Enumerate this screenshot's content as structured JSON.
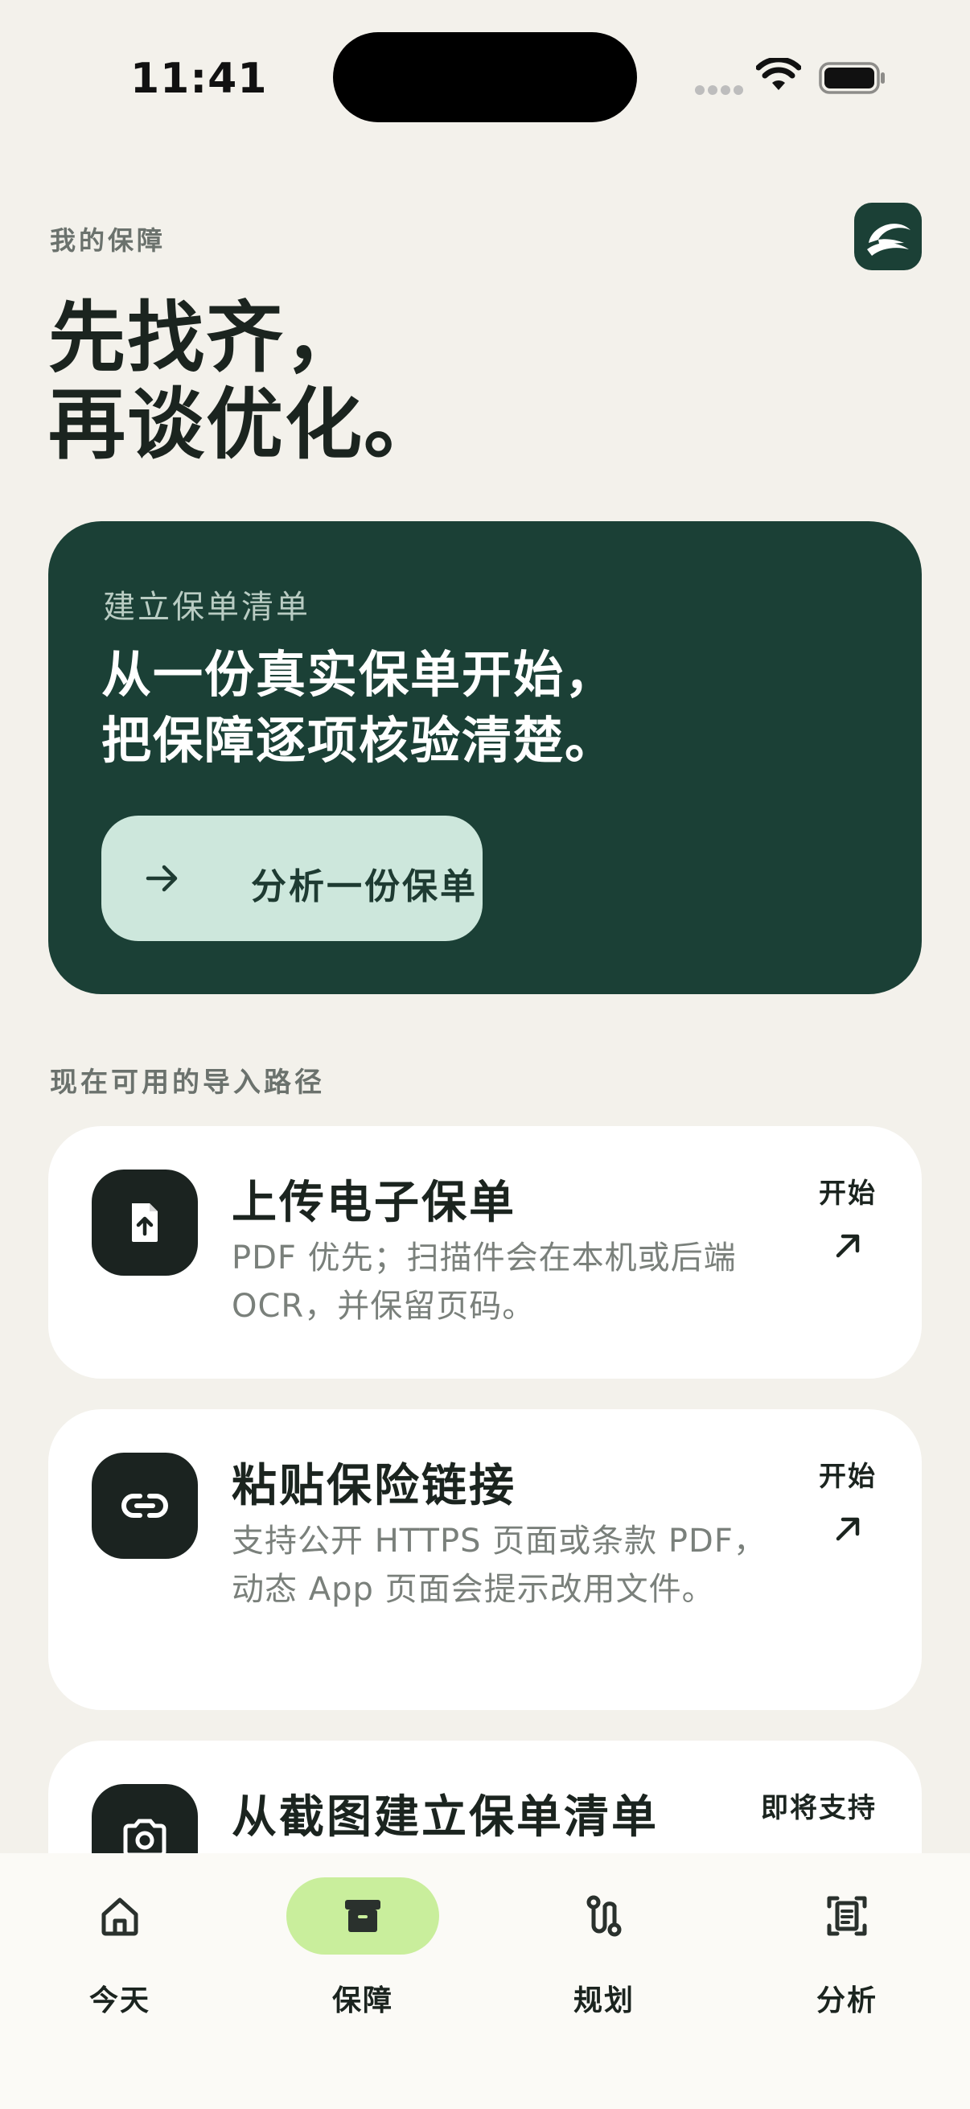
{
  "status_bar": {
    "time": "11:41"
  },
  "header": {
    "eyebrow": "我的保障",
    "headline_line1": "先找齐，",
    "headline_line2": "再谈优化。"
  },
  "hero": {
    "eyebrow": "建立保单清单",
    "title_line1": "从一份真实保单开始，",
    "title_line2": "把保障逐项核验清楚。",
    "cta_label": "分析一份保单"
  },
  "section_label": "现在可用的导入路径",
  "options": [
    {
      "title": "上传电子保单",
      "description": "PDF 优先；扫描件会在本机或后端 OCR，并保留页码。",
      "action": "开始",
      "icon": "file-upload-icon"
    },
    {
      "title": "粘贴保险链接",
      "description": "支持公开 HTTPS 页面或条款 PDF，动态 App 页面会提示改用文件。",
      "action": "开始",
      "icon": "link-icon"
    },
    {
      "title": "从截图建立保单清单",
      "description": "",
      "action": "即将支持",
      "icon": "camera-icon"
    }
  ],
  "tabs": [
    {
      "label": "今天",
      "icon": "home-icon",
      "active": false
    },
    {
      "label": "保障",
      "icon": "archive-icon",
      "active": true
    },
    {
      "label": "规划",
      "icon": "route-icon",
      "active": false
    },
    {
      "label": "分析",
      "icon": "document-scan-icon",
      "active": false
    }
  ],
  "colors": {
    "background": "#F3F1EB",
    "hero": "#1B4036",
    "cta": "#CDE7DC",
    "active_tab": "#C9EE9C",
    "text": "#1B241F",
    "muted": "#7A807B"
  }
}
